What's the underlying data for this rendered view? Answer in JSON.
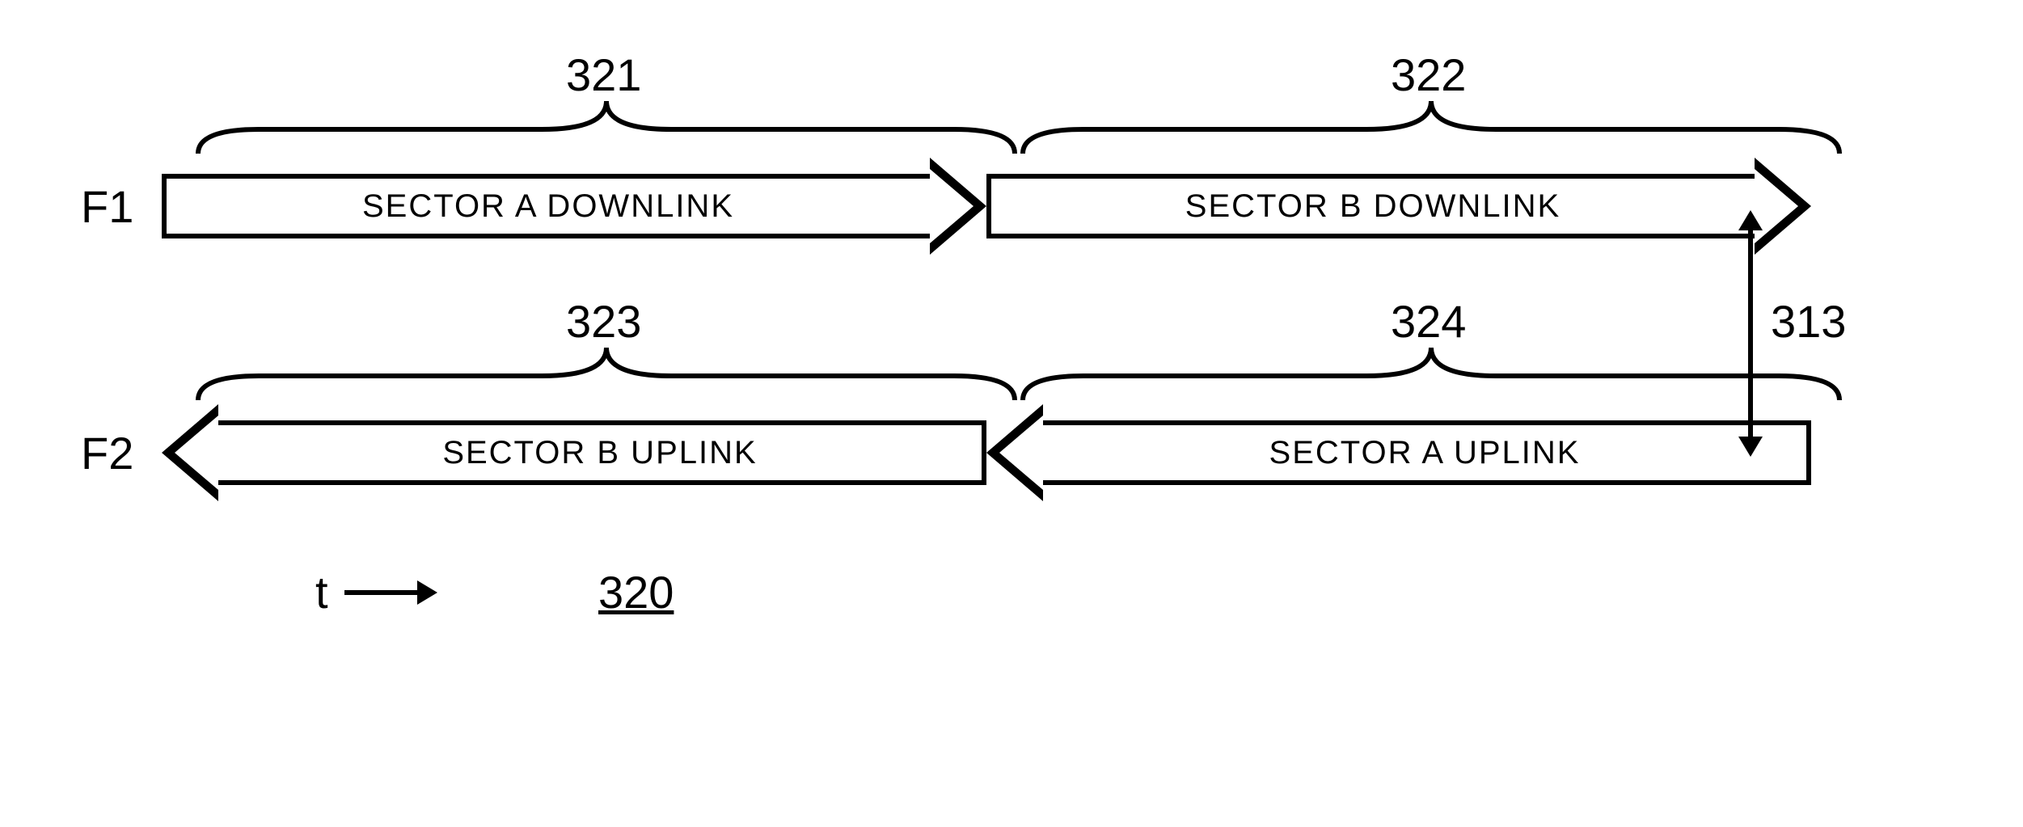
{
  "freq_labels": {
    "f1": "F1",
    "f2": "F2"
  },
  "arrows": {
    "a321": "SECTOR A DOWNLINK",
    "a322": "SECTOR B DOWNLINK",
    "a323": "SECTOR B UPLINK",
    "a324": "SECTOR A UPLINK"
  },
  "refs": {
    "r321": "321",
    "r322": "322",
    "r323": "323",
    "r324": "324",
    "r313": "313"
  },
  "time_label": "t",
  "figure_number": "320"
}
